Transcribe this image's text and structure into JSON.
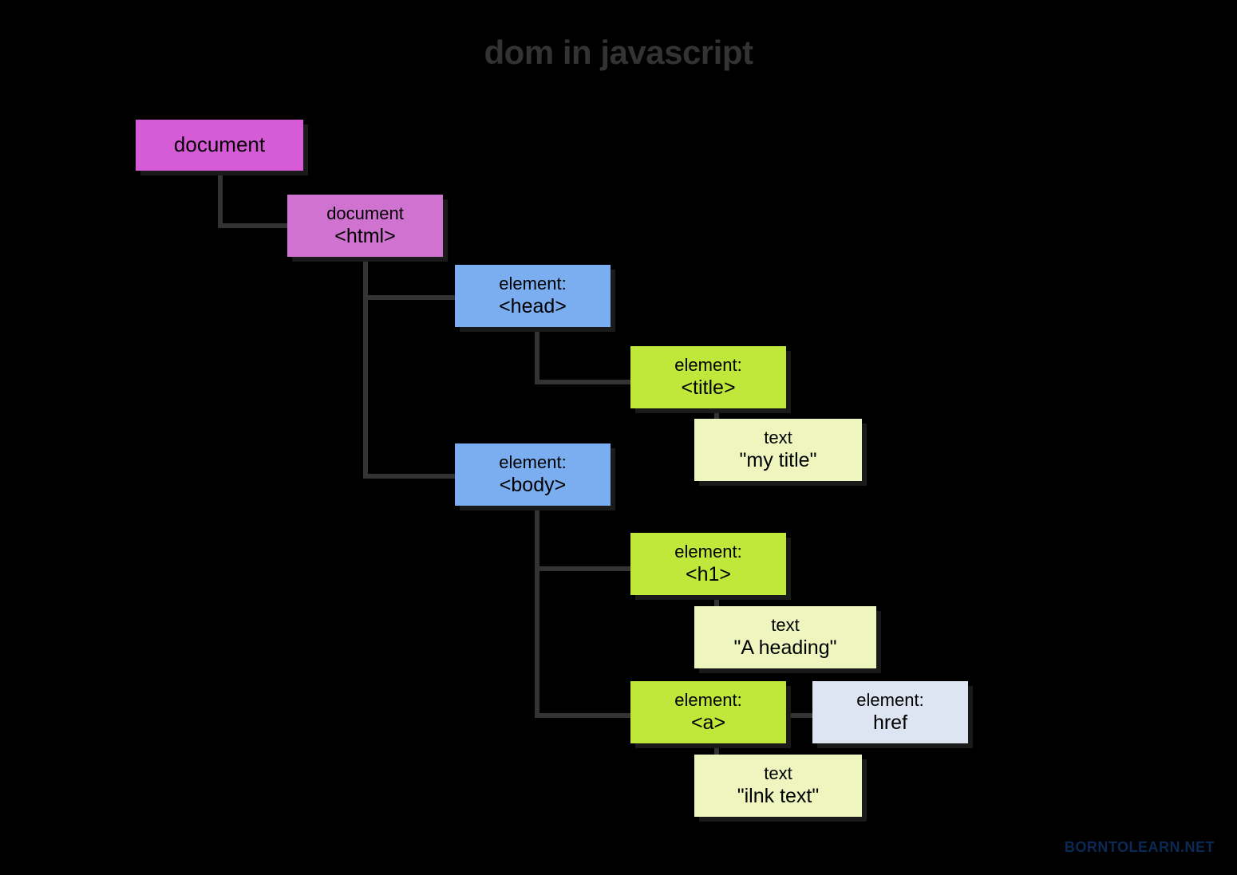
{
  "title": "dom in javascript",
  "nodes": {
    "document": {
      "line1": "document"
    },
    "html": {
      "line1": "document",
      "line2": "<html>"
    },
    "head": {
      "line1": "element:",
      "line2": "<head>"
    },
    "title_el": {
      "line1": "element:",
      "line2": "<title>"
    },
    "title_tx": {
      "line1": "text",
      "line2": "\"my title\""
    },
    "body": {
      "line1": "element:",
      "line2": "<body>"
    },
    "h1": {
      "line1": "element:",
      "line2": "<h1>"
    },
    "h1_tx": {
      "line1": "text",
      "line2": "\"A heading\""
    },
    "a": {
      "line1": "element:",
      "line2": "<a>"
    },
    "href": {
      "line1": "element:",
      "line2": "href"
    },
    "a_tx": {
      "line1": "text",
      "line2": "\"ilnk text\""
    }
  },
  "watermark": "BORNTOLEARN.NET"
}
